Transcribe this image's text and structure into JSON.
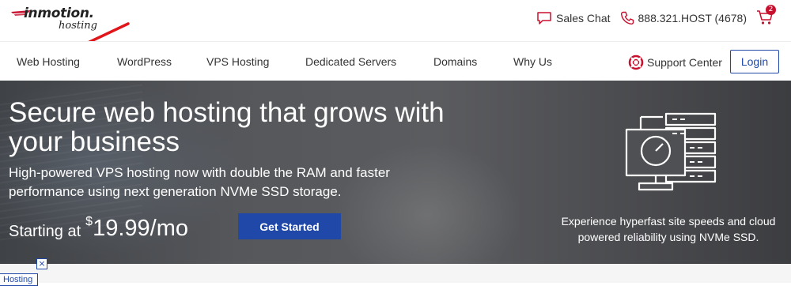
{
  "brand": {
    "logo_main": "inmotion.",
    "logo_sub": "hosting"
  },
  "topbar": {
    "sales_chat": "Sales Chat",
    "phone": "888.321.HOST (4678)",
    "cart_count": "2"
  },
  "nav": {
    "items": [
      {
        "label": "Web Hosting"
      },
      {
        "label": "WordPress"
      },
      {
        "label": "VPS Hosting"
      },
      {
        "label": "Dedicated Servers"
      },
      {
        "label": "Domains"
      },
      {
        "label": "Why Us"
      }
    ],
    "support": "Support Center",
    "login": "Login"
  },
  "hero": {
    "title": "Secure web hosting that grows with your business",
    "subtitle": "High-powered VPS hosting now with double the RAM and faster performance using next generation NVMe SSD storage.",
    "price_label": "Starting at",
    "price_symbol": "$",
    "price_amount": "19.99/mo",
    "cta": "Get Started",
    "caption": "Experience hyperfast site speeds and cloud powered reliability using NVMe SSD."
  },
  "bottom": {
    "tab_label": "Hosting",
    "close": "×"
  },
  "colors": {
    "accent_blue": "#1f48a8",
    "brand_red": "#c8102e",
    "arrow_red": "#e0161b"
  },
  "icons": [
    "chat-icon",
    "phone-icon",
    "cart-icon",
    "lifebuoy-icon",
    "server-speed-icon",
    "annotation-arrow-icon"
  ]
}
